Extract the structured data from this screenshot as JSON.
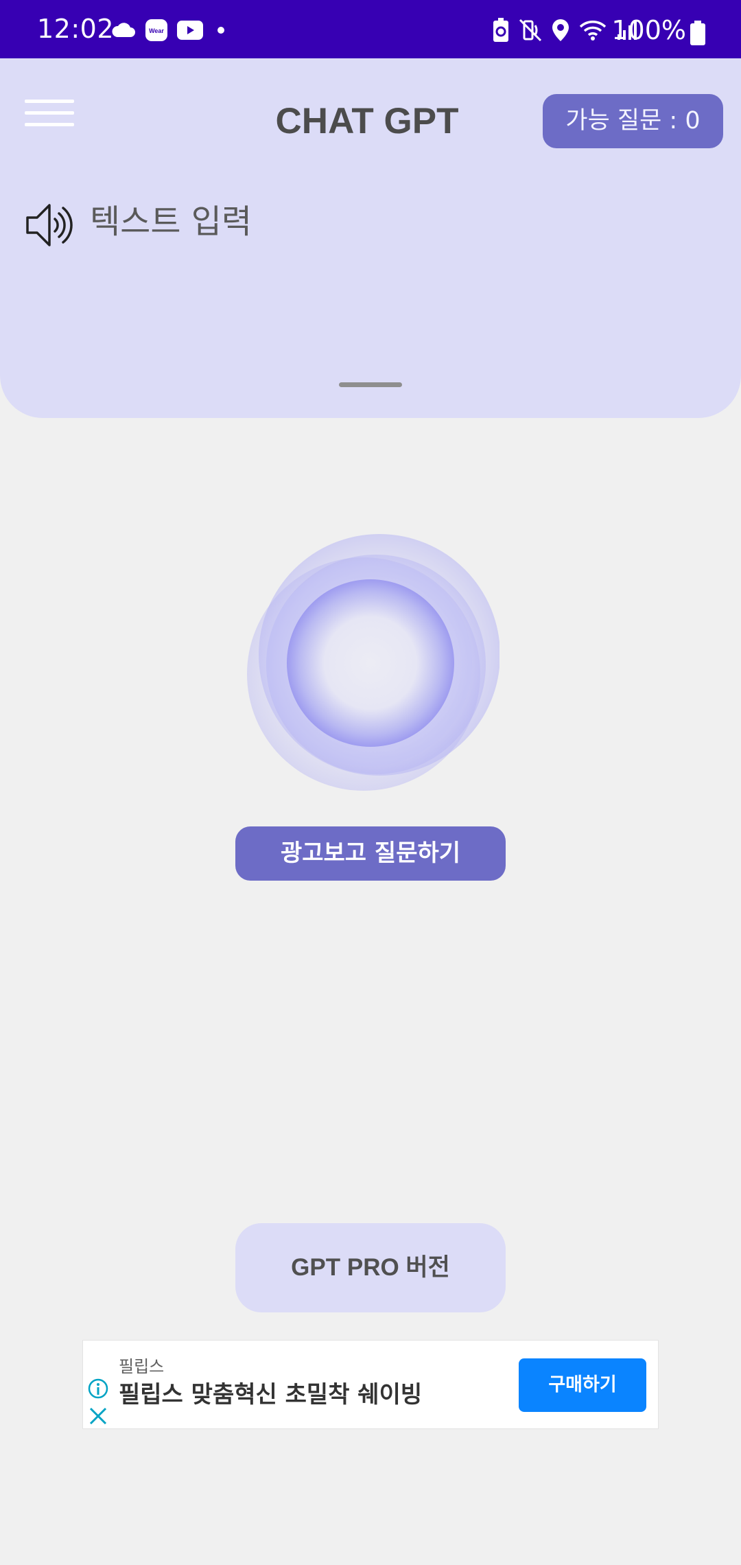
{
  "status_bar": {
    "time": "12:02",
    "battery": "100%",
    "left_icons": [
      "cloud-icon",
      "wear-icon",
      "youtube-icon",
      "dot-icon"
    ],
    "right_icons": [
      "battery-saver-icon",
      "mute-icon",
      "location-icon",
      "wifi-icon",
      "signal-icon",
      "battery-icon"
    ],
    "wear_label": "Wear"
  },
  "header": {
    "title": "CHAT GPT",
    "quota_label": "가능 질문 : 0",
    "menu_icon": "hamburger-menu-icon"
  },
  "input": {
    "label": "텍스트 입력",
    "icon": "speaker-icon"
  },
  "actions": {
    "ad_question_label": "광고보고 질문하기",
    "pro_label": "GPT PRO 버전"
  },
  "ad": {
    "advertiser": "필립스",
    "headline": "필립스 맞춤혁신 초밀착 쉐이빙",
    "cta_label": "구매하기",
    "cta_color": "#0a84ff"
  },
  "colors": {
    "status_bar": "#3700b3",
    "panel": "#dcdcf7",
    "accent": "#6d6cc6",
    "background": "#f0f0f0"
  }
}
